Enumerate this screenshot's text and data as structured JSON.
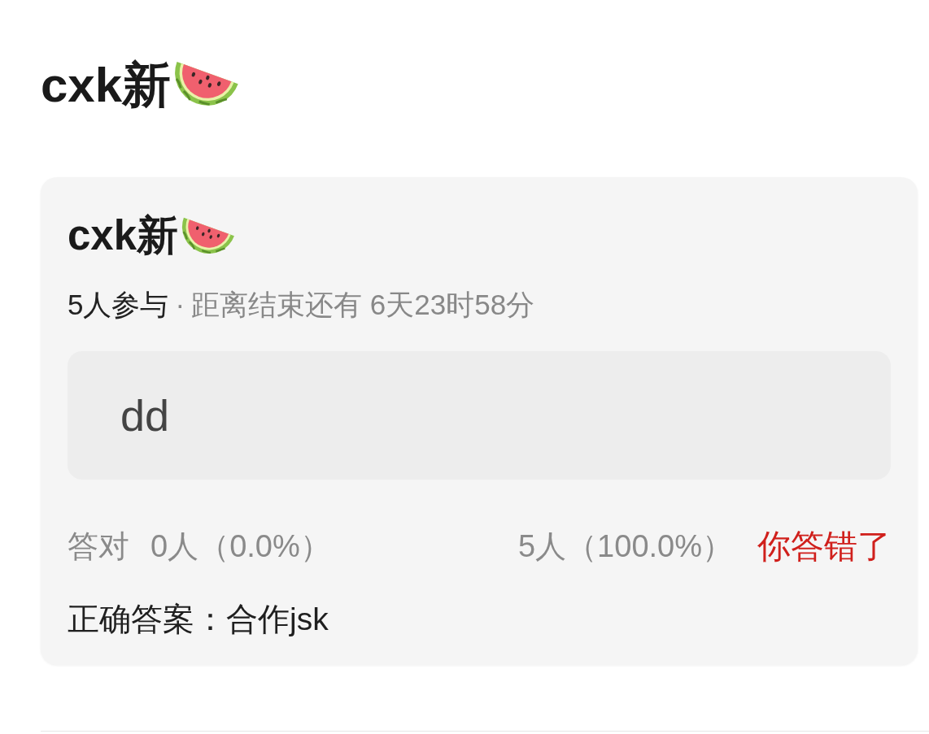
{
  "header": {
    "title": "cxk新"
  },
  "poll": {
    "title": "cxk新",
    "participants": "5人参与",
    "separator": "·",
    "countdown": "距离结束还有 6天23时58分",
    "options": [
      {
        "label": "dd"
      }
    ],
    "result": {
      "correct_label": "答对",
      "correct_count": "0人（0.0%）",
      "wrong_count": "5人（100.0%）",
      "verdict": "你答错了"
    },
    "answer": {
      "label": "正确答案：",
      "value": "合作jsk"
    }
  }
}
